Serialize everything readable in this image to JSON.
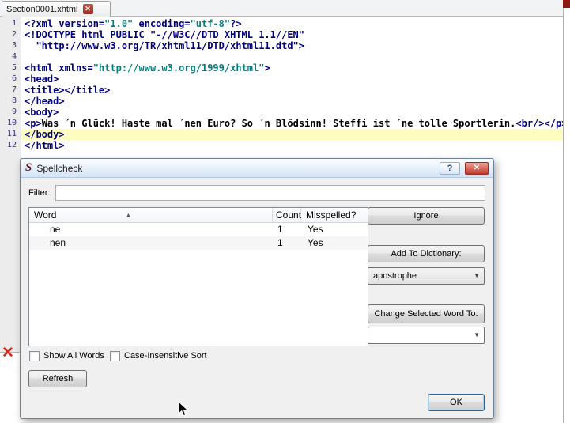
{
  "window": {
    "tab_title": "Section0001.xhtml",
    "tab_close": "✕"
  },
  "editor": {
    "highlight_line": 11,
    "lines": [
      {
        "n": 1,
        "tokens": [
          {
            "c": "tag",
            "t": "<?xml version="
          },
          {
            "c": "val",
            "t": "\"1.0\""
          },
          {
            "c": "tag",
            "t": " encoding="
          },
          {
            "c": "val",
            "t": "\"utf-8\""
          },
          {
            "c": "tag",
            "t": "?>"
          }
        ]
      },
      {
        "n": 2,
        "tokens": [
          {
            "c": "tag",
            "t": "<!DOCTYPE html PUBLIC \"-//W3C//DTD XHTML 1.1//EN\""
          }
        ]
      },
      {
        "n": 3,
        "tokens": [
          {
            "c": "tag",
            "t": "  \"http://www.w3.org/TR/xhtml11/DTD/xhtml11.dtd\">"
          }
        ]
      },
      {
        "n": 4,
        "tokens": []
      },
      {
        "n": 5,
        "tokens": [
          {
            "c": "tag",
            "t": "<html xmlns="
          },
          {
            "c": "val",
            "t": "\"http://www.w3.org/1999/xhtml\""
          },
          {
            "c": "tag",
            "t": ">"
          }
        ]
      },
      {
        "n": 6,
        "tokens": [
          {
            "c": "tag",
            "t": "<head>"
          }
        ]
      },
      {
        "n": 7,
        "tokens": [
          {
            "c": "tag",
            "t": "<title></title>"
          }
        ]
      },
      {
        "n": 8,
        "tokens": [
          {
            "c": "tag",
            "t": "</head>"
          }
        ]
      },
      {
        "n": 9,
        "tokens": [
          {
            "c": "tag",
            "t": "<body>"
          }
        ]
      },
      {
        "n": 10,
        "tokens": [
          {
            "c": "tag",
            "t": "<p>"
          },
          {
            "c": "txt",
            "t": "Was ´n Glück! Haste mal ´"
          },
          {
            "c": "err",
            "t": "nen"
          },
          {
            "c": "txt",
            "t": " Euro? So ´n Blödsinn! Steffi ist ´"
          },
          {
            "c": "err",
            "t": "ne"
          },
          {
            "c": "txt",
            "t": " tolle Sportlerin."
          },
          {
            "c": "tag",
            "t": "<br/></p>"
          }
        ]
      },
      {
        "n": 11,
        "tokens": [
          {
            "c": "tag",
            "t": "</body>"
          }
        ]
      },
      {
        "n": 12,
        "tokens": [
          {
            "c": "tag",
            "t": "</html>"
          }
        ]
      }
    ]
  },
  "dialog": {
    "title": "Spellcheck",
    "icon": "S",
    "help_label": "?",
    "close_label": "✕",
    "filter_label": "Filter:",
    "filter_value": "",
    "table": {
      "columns": [
        "Word",
        "Count",
        "Misspelled?"
      ],
      "sort_indicator": "▲",
      "rows": [
        {
          "word": "ne",
          "count": "1",
          "misspelled": "Yes"
        },
        {
          "word": "nen",
          "count": "1",
          "misspelled": "Yes"
        }
      ]
    },
    "ignore_button": "Ignore",
    "add_to_dictionary_button": "Add To Dictionary:",
    "dictionary_select": "apostrophe",
    "change_word_button": "Change Selected Word To:",
    "change_word_select": "",
    "dropdown_arrow": "▼",
    "show_all_words_checkbox": "Show All Words",
    "case_insensitive_checkbox": "Case-Insensitive Sort",
    "refresh_button": "Refresh",
    "ok_button": "OK"
  },
  "background": {
    "error_icon": "✕"
  },
  "colors": {
    "tag_text": "#00007f",
    "value_text": "#007f7f",
    "highlight_line_bg": "#fdfdc0",
    "close_button_red": "#c2372a",
    "error_red": "#d6281e"
  }
}
